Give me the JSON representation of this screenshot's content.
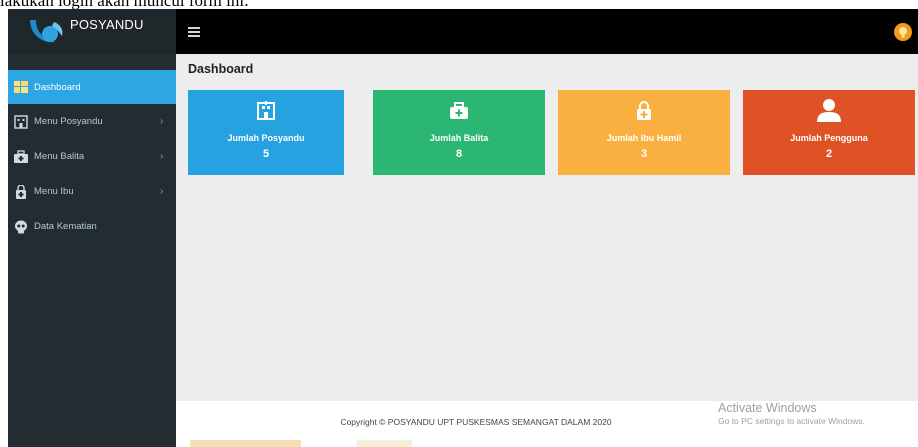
{
  "page_caption": "lakukan login akan muncul form ini:",
  "app": {
    "brand": "POSYANDU"
  },
  "sidebar": {
    "items": [
      {
        "label": "Dashboard",
        "icon": "dashboard-icon",
        "active": true,
        "has_submenu": false
      },
      {
        "label": "Menu Posyandu",
        "icon": "building-icon",
        "active": false,
        "has_submenu": true
      },
      {
        "label": "Menu Balita",
        "icon": "medkit-icon",
        "active": false,
        "has_submenu": true
      },
      {
        "label": "Menu Ibu",
        "icon": "medkit-icon",
        "active": false,
        "has_submenu": true
      },
      {
        "label": "Data Kematian",
        "icon": "skull-icon",
        "active": false,
        "has_submenu": false
      }
    ]
  },
  "header": {
    "menu_toggle_icon": "hamburger-icon",
    "user_icon": "user-avatar-icon"
  },
  "main": {
    "title": "Dashboard",
    "cards": [
      {
        "label": "Jumlah Posyandu",
        "value": "5",
        "color": "#27a2e1",
        "icon": "building-icon"
      },
      {
        "label": "Jumlah Balita",
        "value": "8",
        "color": "#2bb673",
        "icon": "medkit-icon"
      },
      {
        "label": "Jumlah Ibu Hamil",
        "value": "3",
        "color": "#f9b040",
        "icon": "medkit-icon"
      },
      {
        "label": "Jumlah Pengguna",
        "value": "2",
        "color": "#df5226",
        "icon": "user-icon"
      }
    ]
  },
  "footer": {
    "copyright": "Copyright © POSYANDU UPT PUSKESMAS SEMANGAT DALAM 2020"
  },
  "watermark": {
    "title": "Activate Windows",
    "subtitle": "Go to PC settings to activate Windows."
  },
  "colors": {
    "sidebar": "#222d32",
    "active": "#2ca7e4",
    "topbar": "#000000",
    "content": "#ededed"
  }
}
